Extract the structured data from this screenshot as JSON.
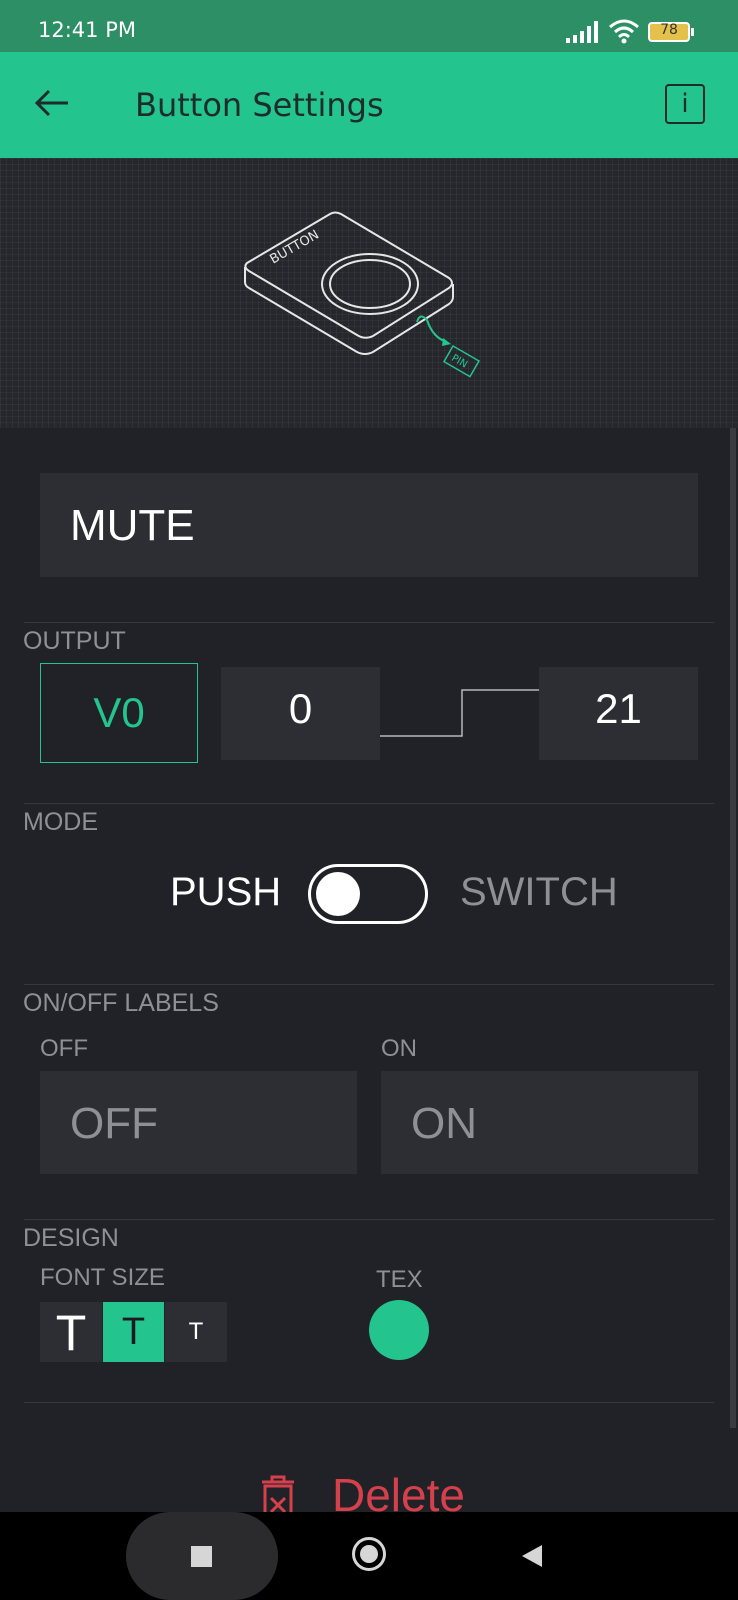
{
  "status": {
    "time": "12:41 PM",
    "battery": "78"
  },
  "appbar": {
    "title": "Button Settings",
    "info": "i"
  },
  "hero": {
    "device_label": "BUTTON",
    "pin_label": "PIN"
  },
  "name_field": {
    "value": "MUTE"
  },
  "output": {
    "section_label": "OUTPUT",
    "pin": "V0",
    "min": "0",
    "max": "21"
  },
  "mode": {
    "section_label": "MODE",
    "left_label": "PUSH",
    "right_label": "SWITCH",
    "is_switch": false
  },
  "labels": {
    "section_label": "ON/OFF LABELS",
    "off_caption": "OFF",
    "on_caption": "ON",
    "off_value": "OFF",
    "on_value": "ON"
  },
  "design": {
    "section_label": "DESIGN",
    "font_size_label": "FONT SIZE",
    "text_color_label": "TEX",
    "font_options": [
      "T",
      "T",
      "T"
    ],
    "selected_font_index": 1,
    "text_color": "#23c48e"
  },
  "delete": {
    "label": "Delete"
  },
  "colors": {
    "accent": "#23c48e",
    "danger": "#d4404b"
  }
}
